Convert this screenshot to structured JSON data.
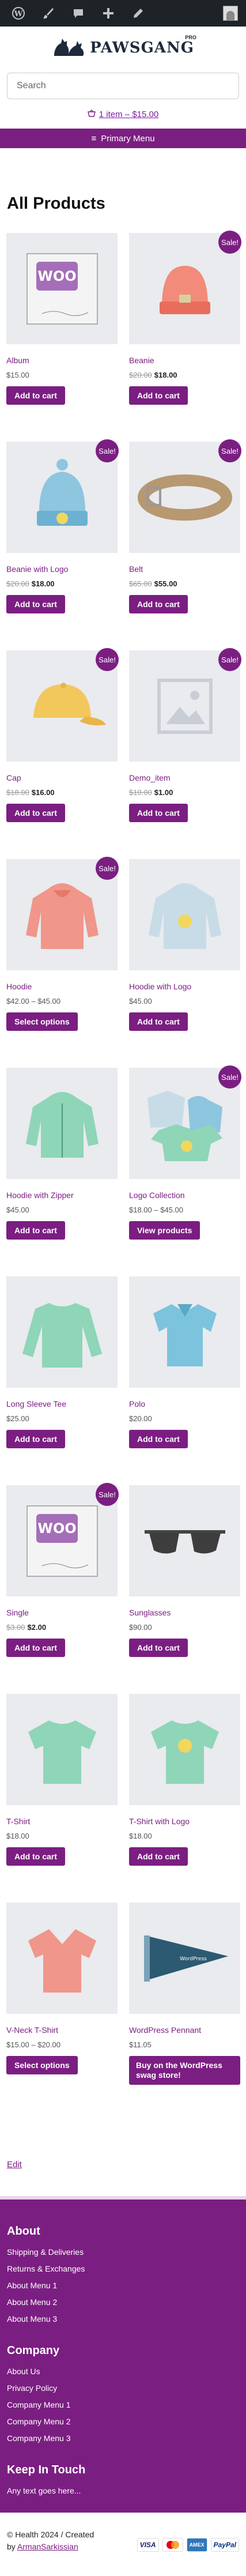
{
  "admin_bar": {
    "icons": [
      "wordpress-icon",
      "paintbrush-icon",
      "comments-icon",
      "plus-icon",
      "pencil-icon"
    ]
  },
  "header": {
    "logo_text": "PAWSGANG",
    "logo_tm": "PRO",
    "search_placeholder": "Search",
    "cart_label": "1 item – $15.00",
    "menu_label": "Primary Menu"
  },
  "page": {
    "title": "All Products"
  },
  "products": [
    {
      "name": "Album",
      "sale": false,
      "price": "$15.00",
      "old": "",
      "new": "",
      "button": "Add to cart",
      "img": "album"
    },
    {
      "name": "Beanie",
      "sale": true,
      "price": "",
      "old": "$20.00",
      "new": "$18.00",
      "button": "Add to cart",
      "img": "beanie"
    },
    {
      "name": "Beanie with Logo",
      "sale": true,
      "price": "",
      "old": "$20.00",
      "new": "$18.00",
      "button": "Add to cart",
      "img": "beanie-logo"
    },
    {
      "name": "Belt",
      "sale": true,
      "price": "",
      "old": "$65.00",
      "new": "$55.00",
      "button": "Add to cart",
      "img": "belt"
    },
    {
      "name": "Cap",
      "sale": true,
      "price": "",
      "old": "$18.00",
      "new": "$16.00",
      "button": "Add to cart",
      "img": "cap"
    },
    {
      "name": "Demo_item",
      "sale": true,
      "price": "",
      "old": "$10.00",
      "new": "$1.00",
      "button": "Add to cart",
      "img": "placeholder"
    },
    {
      "name": "Hoodie",
      "sale": true,
      "price": "$42.00 – $45.00",
      "old": "",
      "new": "",
      "button": "Select options",
      "img": "hoodie"
    },
    {
      "name": "Hoodie with Logo",
      "sale": false,
      "price": "$45.00",
      "old": "",
      "new": "",
      "button": "Add to cart",
      "img": "hoodie-logo"
    },
    {
      "name": "Hoodie with Zipper",
      "sale": false,
      "price": "$45.00",
      "old": "",
      "new": "",
      "button": "Add to cart",
      "img": "hoodie-zip"
    },
    {
      "name": "Logo Collection",
      "sale": true,
      "price": "$18.00 – $45.00",
      "old": "",
      "new": "",
      "button": "View products",
      "img": "collection"
    },
    {
      "name": "Long Sleeve Tee",
      "sale": false,
      "price": "$25.00",
      "old": "",
      "new": "",
      "button": "Add to cart",
      "img": "longsleeve"
    },
    {
      "name": "Polo",
      "sale": false,
      "price": "$20.00",
      "old": "",
      "new": "",
      "button": "Add to cart",
      "img": "polo"
    },
    {
      "name": "Single",
      "sale": true,
      "price": "",
      "old": "$3.00",
      "new": "$2.00",
      "button": "Add to cart",
      "img": "album"
    },
    {
      "name": "Sunglasses",
      "sale": false,
      "price": "$90.00",
      "old": "",
      "new": "",
      "button": "Add to cart",
      "img": "sunglasses"
    },
    {
      "name": "T-Shirt",
      "sale": false,
      "price": "$18.00",
      "old": "",
      "new": "",
      "button": "Add to cart",
      "img": "tshirt"
    },
    {
      "name": "T-Shirt with Logo",
      "sale": false,
      "price": "$18.00",
      "old": "",
      "new": "",
      "button": "Add to cart",
      "img": "tshirt-logo"
    },
    {
      "name": "V-Neck T-Shirt",
      "sale": false,
      "price": "$15.00 – $20.00",
      "old": "",
      "new": "",
      "button": "Select options",
      "img": "vneck"
    },
    {
      "name": "WordPress Pennant",
      "sale": false,
      "price": "$11.05",
      "old": "",
      "new": "",
      "button": "Buy on the WordPress swag store!",
      "img": "pennant"
    }
  ],
  "sale_label": "Sale!",
  "edit_label": "Edit",
  "footer": {
    "about": {
      "title": "About",
      "items": [
        "Shipping & Deliveries",
        "Returns & Exchanges",
        "About Menu 1",
        "About Menu 2",
        "About Menu 3"
      ]
    },
    "company": {
      "title": "Company",
      "items": [
        "About Us",
        "Privacy Policy",
        "Company Menu 1",
        "Company Menu 2",
        "Company Menu 3"
      ]
    },
    "touch": {
      "title": "Keep In Touch",
      "text": "Any text goes here..."
    }
  },
  "bottom": {
    "credit": "© Health 2024 / Created",
    "by": "by",
    "author": "ArmanSarkissian",
    "payments": [
      "VISA",
      "Mastercard",
      "Amex",
      "PayPal"
    ]
  },
  "colors": {
    "accent": "#7b1e82",
    "adminbar": "#1d2327"
  }
}
